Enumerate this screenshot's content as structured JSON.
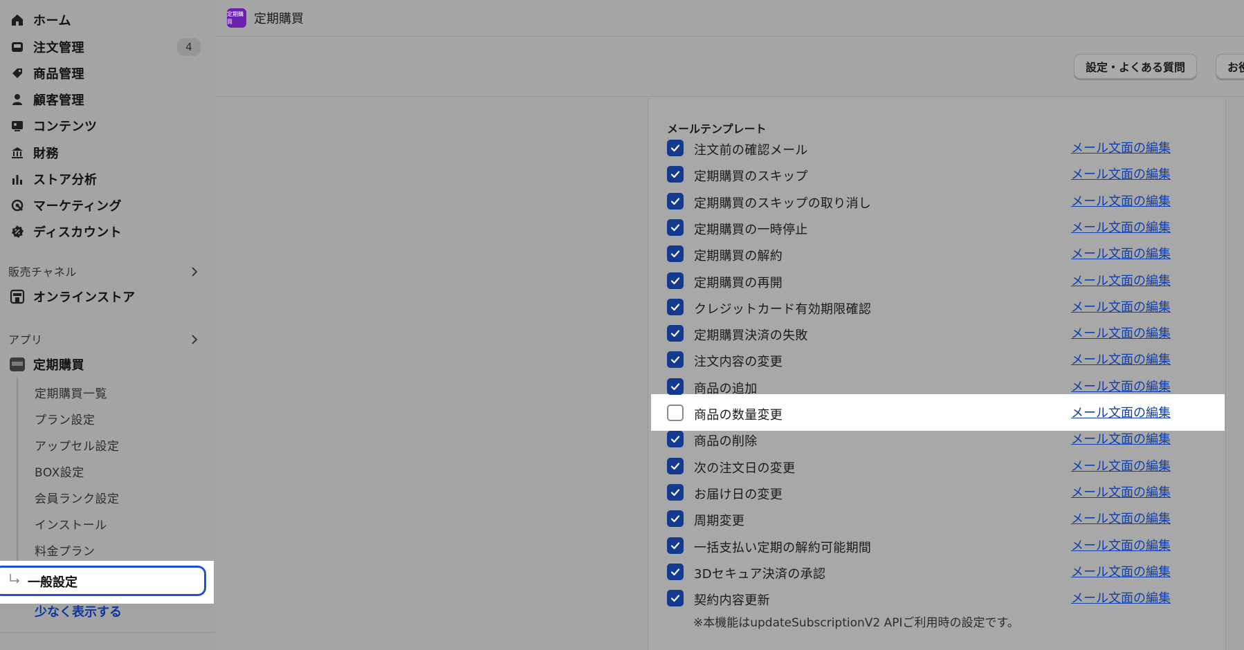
{
  "sidebar": {
    "nav": [
      {
        "label": "ホーム",
        "icon": "home-icon"
      },
      {
        "label": "注文管理",
        "icon": "inbox-icon",
        "badge": "4"
      },
      {
        "label": "商品管理",
        "icon": "tag-icon"
      },
      {
        "label": "顧客管理",
        "icon": "person-icon"
      },
      {
        "label": "コンテンツ",
        "icon": "image-icon"
      },
      {
        "label": "財務",
        "icon": "bank-icon"
      },
      {
        "label": "ストア分析",
        "icon": "bar-chart-icon"
      },
      {
        "label": "マーケティング",
        "icon": "target-icon"
      },
      {
        "label": "ディスカウント",
        "icon": "discount-icon"
      }
    ],
    "sales_channel": {
      "title": "販売チャネル",
      "item": "オンラインストア"
    },
    "apps": {
      "title": "アプリ",
      "app": "定期購買",
      "sub": [
        "定期購買一覧",
        "プラン設定",
        "アップセル設定",
        "BOX設定",
        "会員ランク設定",
        "インストール",
        "料金プラン"
      ],
      "active": "一般設定",
      "show_less": "少なく表示する"
    }
  },
  "header": {
    "app_title": "定期購買",
    "logo_text": "定期購買"
  },
  "toolbar": {
    "faq_button": "設定・よくある質問",
    "second_button": "お役"
  },
  "mail": {
    "title": "メールテンプレート",
    "link_label": "メール文面の編集",
    "items": [
      {
        "label": "注文前の確認メール",
        "checked": true
      },
      {
        "label": "定期購買のスキップ",
        "checked": true
      },
      {
        "label": "定期購買のスキップの取り消し",
        "checked": true
      },
      {
        "label": "定期購買の一時停止",
        "checked": true
      },
      {
        "label": "定期購買の解約",
        "checked": true
      },
      {
        "label": "定期購買の再開",
        "checked": true
      },
      {
        "label": "クレジットカード有効期限確認",
        "checked": true
      },
      {
        "label": "定期購買決済の失敗",
        "checked": true
      },
      {
        "label": "注文内容の変更",
        "checked": true
      },
      {
        "label": "商品の追加",
        "checked": true
      },
      {
        "label": "商品の数量変更",
        "checked": false
      },
      {
        "label": "商品の削除",
        "checked": true
      },
      {
        "label": "次の注文日の変更",
        "checked": true
      },
      {
        "label": "お届け日の変更",
        "checked": true
      },
      {
        "label": "周期変更",
        "checked": true
      },
      {
        "label": "一括支払い定期の解約可能期間",
        "checked": true
      },
      {
        "label": "3Dセキュア決済の承認",
        "checked": true
      },
      {
        "label": "契約内容更新",
        "checked": true
      }
    ],
    "note": "※本機能はupdateSubscriptionV2 APIご利用時の設定です。"
  }
}
